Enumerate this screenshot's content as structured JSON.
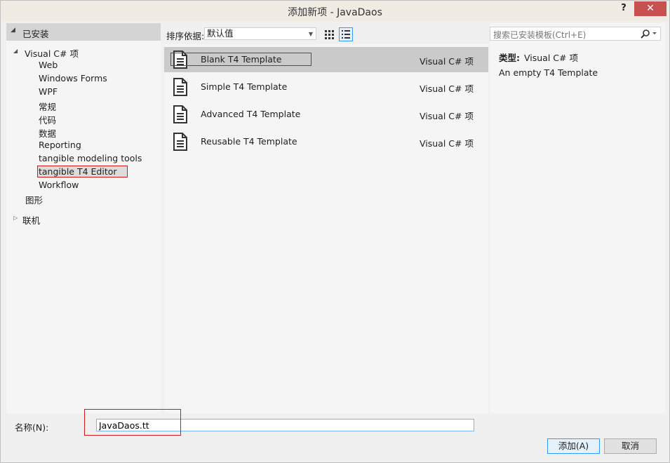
{
  "window": {
    "title": "添加新项 - JavaDaos",
    "help": "?",
    "close": "✕"
  },
  "left": {
    "installed": "已安装",
    "tree": [
      {
        "label": "Visual C# 项"
      },
      {
        "label": "Web"
      },
      {
        "label": "Windows Forms"
      },
      {
        "label": "WPF"
      },
      {
        "label": "常规"
      },
      {
        "label": "代码"
      },
      {
        "label": "数据"
      },
      {
        "label": "Reporting"
      },
      {
        "label": "tangible modeling tools"
      },
      {
        "label": "tangible T4 Editor"
      },
      {
        "label": "Workflow"
      },
      {
        "label": "图形"
      },
      {
        "label": "联机"
      }
    ]
  },
  "toolbar": {
    "sort_label": "排序依据:",
    "sort_value": "默认值"
  },
  "items": [
    {
      "name": "Blank T4 Template",
      "kind": "Visual C# 项"
    },
    {
      "name": "Simple T4 Template",
      "kind": "Visual C# 项"
    },
    {
      "name": "Advanced T4 Template",
      "kind": "Visual C# 项"
    },
    {
      "name": "Reusable T4 Template",
      "kind": "Visual C# 项"
    }
  ],
  "details": {
    "search_placeholder": "搜索已安装模板(Ctrl+E)",
    "type_label": "类型:",
    "type_value": "Visual C# 项",
    "description": "An empty T4 Template"
  },
  "bottom": {
    "name_label": "名称(N):",
    "name_value": "JavaDaos.tt",
    "add_button": "添加(A)",
    "cancel_button": "取消"
  },
  "colors": {
    "highlight_border": "#d0191a",
    "selected_row": "#cacaca",
    "focus_blue": "#3399ff"
  }
}
